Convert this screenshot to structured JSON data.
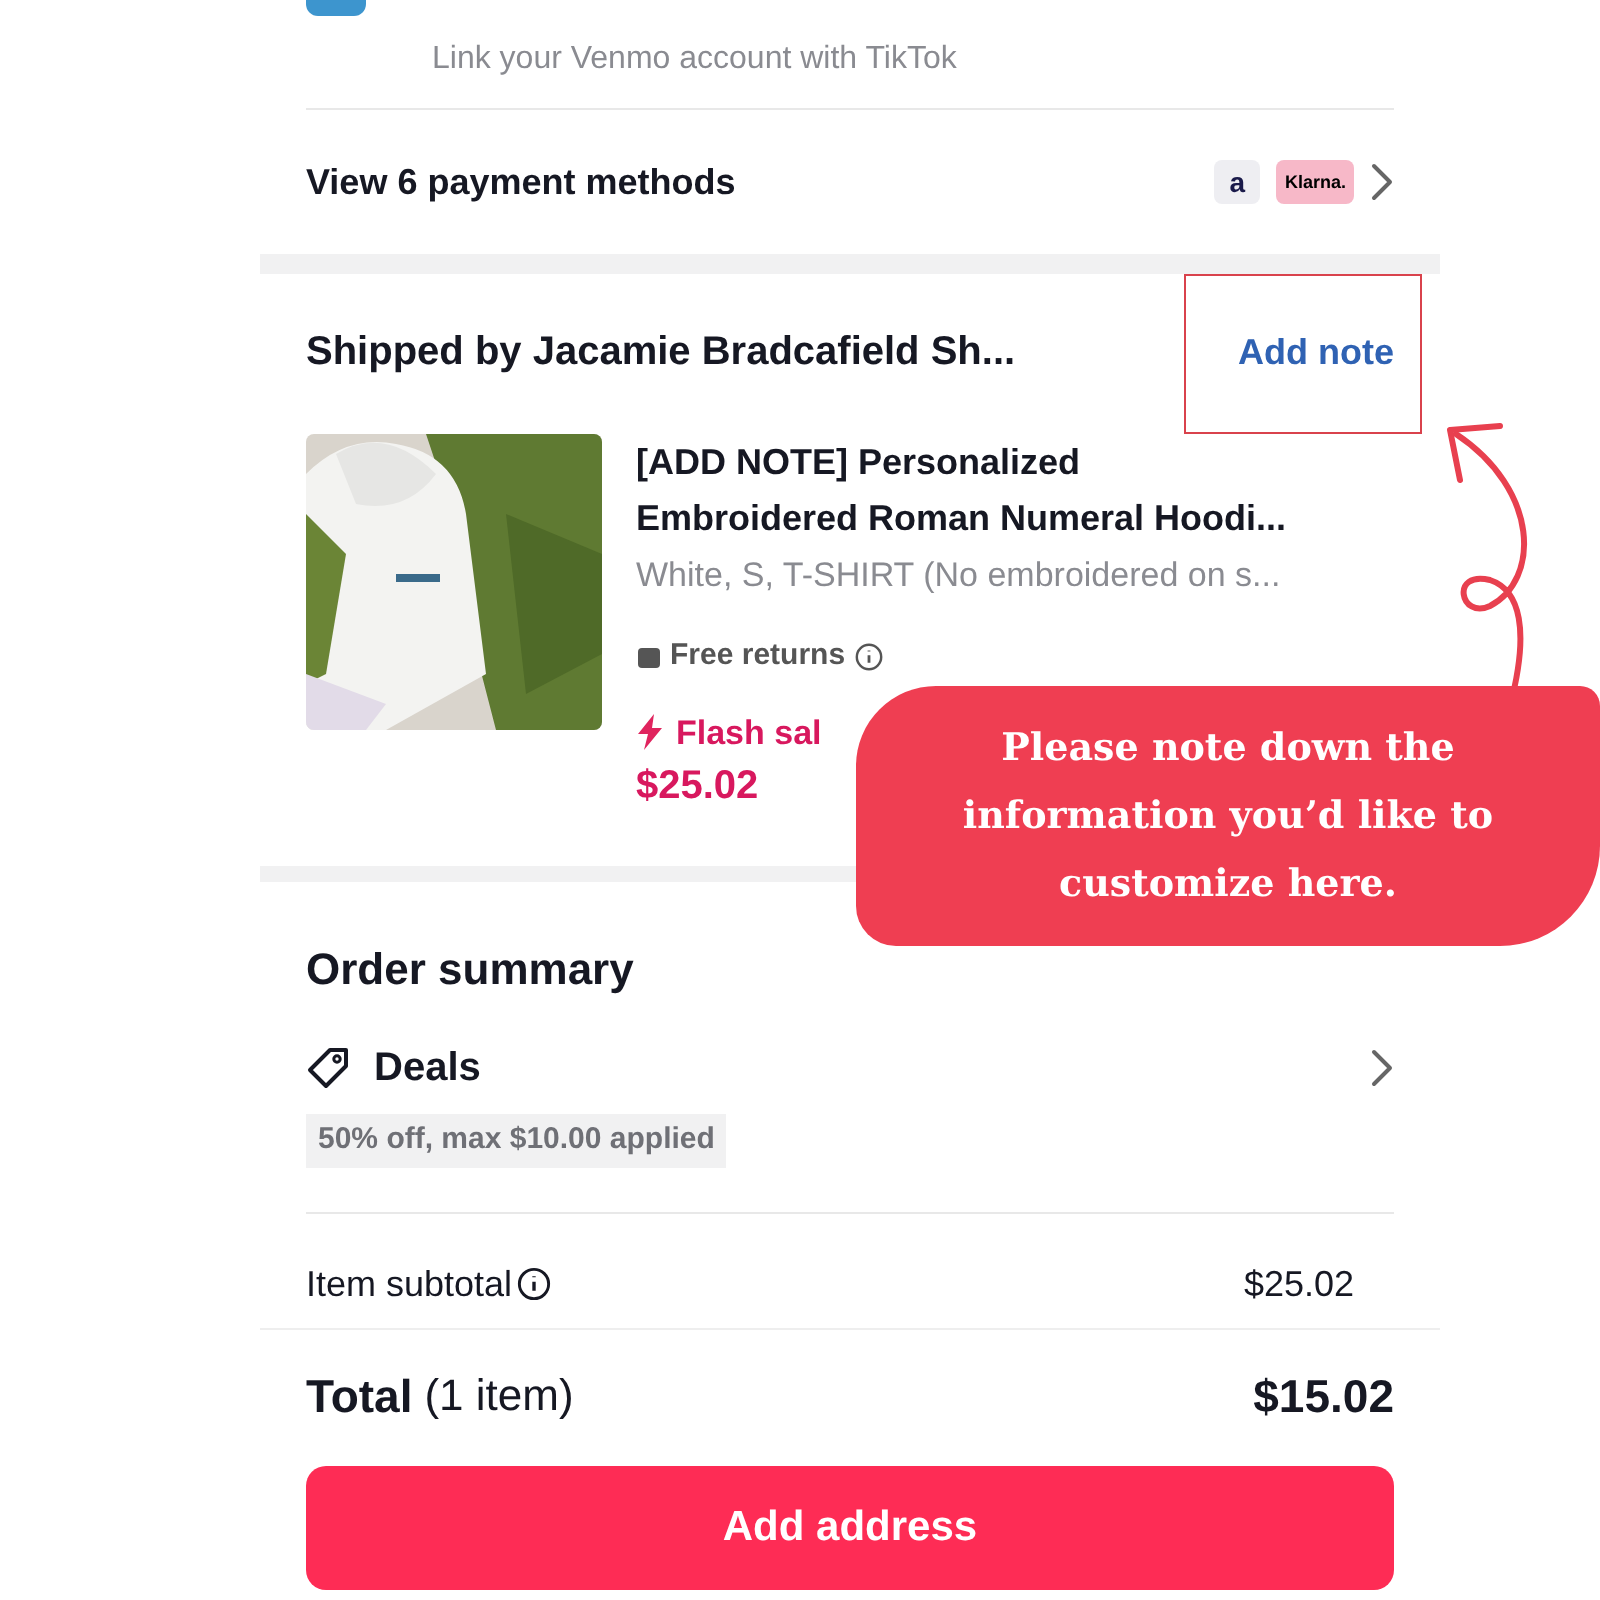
{
  "venmo": {
    "subtitle": "Link your Venmo account with TikTok"
  },
  "payment_methods": {
    "label": "View 6 payment methods",
    "badges": [
      {
        "kind": "affirm",
        "text": "a"
      },
      {
        "kind": "klarna",
        "text": "Klarna."
      }
    ]
  },
  "shipment": {
    "seller": "Shipped by Jacamie Bradcafield Sh...",
    "add_note": "Add note",
    "product": {
      "title_lines": [
        "[ADD NOTE] Personalized",
        "Embroidered Roman Numeral Hoodi..."
      ],
      "variant": "White, S, T-SHIRT (No embroidered on s...",
      "returns": "Free returns",
      "flash": "Flash sal",
      "price": "$25.02"
    }
  },
  "order_summary": {
    "title": "Order summary",
    "deals": "Deals",
    "deal_chip": "50% off, max $10.00 applied",
    "subtotal_label": "Item subtotal",
    "subtotal": "$25.02"
  },
  "total": {
    "label": "Total",
    "count": "(1 item)",
    "amount": "$15.02"
  },
  "button": "Add address",
  "annotation": {
    "text": "Please note down the information you’d like to customize here."
  }
}
